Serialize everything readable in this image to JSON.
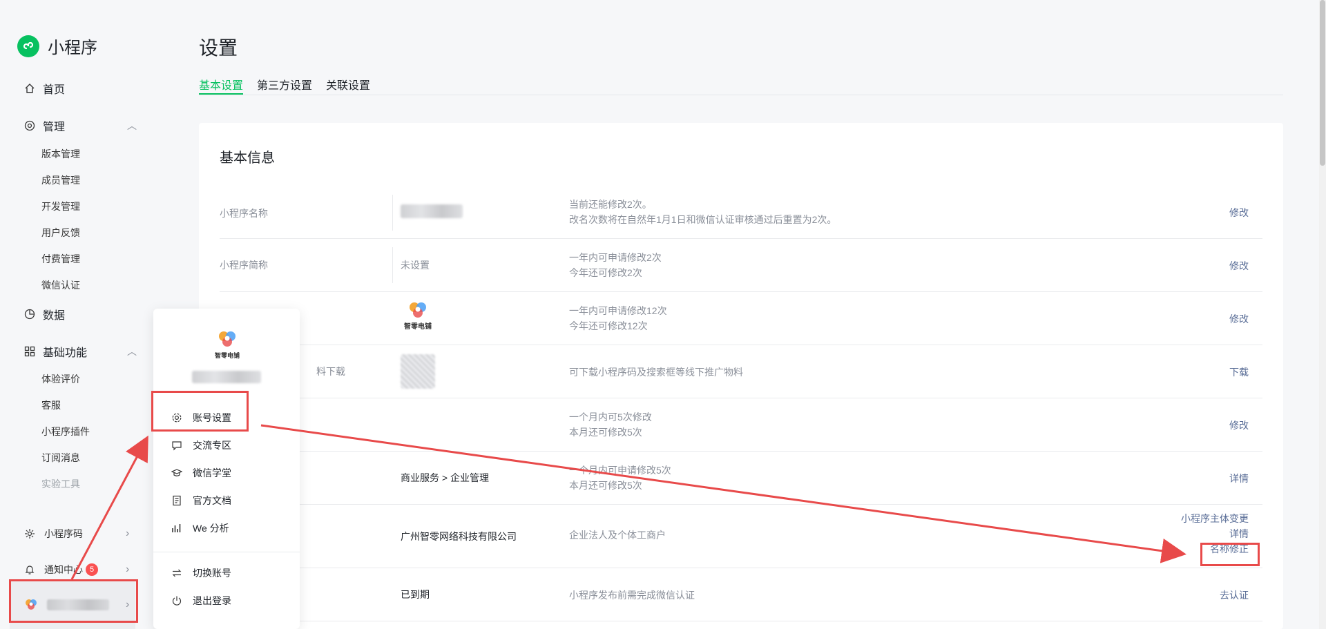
{
  "app": {
    "title": "小程序"
  },
  "sidebar": {
    "home": "首页",
    "manage": "管理",
    "manage_items": [
      "版本管理",
      "成员管理",
      "开发管理",
      "用户反馈",
      "付费管理",
      "微信认证"
    ],
    "data": "数据",
    "basic": "基础功能",
    "basic_items": [
      "体验评价",
      "客服",
      "小程序插件",
      "订阅消息",
      "实验工具"
    ],
    "qrcode": "小程序码",
    "notify": "通知中心",
    "notify_count": "5"
  },
  "page": {
    "title": "设置",
    "tabs": [
      "基本设置",
      "第三方设置",
      "关联设置"
    ],
    "card_title": "基本信息"
  },
  "rows": [
    {
      "label": "小程序名称",
      "value": "",
      "desc1": "当前还能修改2次。",
      "desc2": "改名次数将在自然年1月1日和微信认证审核通过后重置为2次。",
      "action": "修改"
    },
    {
      "label": "小程序简称",
      "value": "未设置",
      "desc1": "一年内可申请修改2次",
      "desc2": "今年还可修改2次",
      "action": "修改"
    },
    {
      "label": "",
      "value": "",
      "logo_caption": "智零电铺",
      "desc1": "一年内可申请修改12次",
      "desc2": "今年还可修改12次",
      "action": "修改"
    },
    {
      "label": "料下载",
      "value": "",
      "desc1": "可下载小程序码及搜索框等线下推广物料",
      "desc2": "",
      "action": "下载"
    },
    {
      "label": "",
      "value": "",
      "desc1": "一个月内可5次修改",
      "desc2": "本月还可修改5次",
      "action": "修改"
    },
    {
      "label": "",
      "value": "商业服务 > 企业管理",
      "desc1": "一个月内可申请修改5次",
      "desc2": "本月还可修改5次",
      "action": "详情"
    },
    {
      "label": "",
      "value": "广州智零网络科技有限公司",
      "desc1": "企业法人及个体工商户",
      "desc2": "",
      "actions": [
        "小程序主体变更",
        "详情",
        "名称修正"
      ]
    },
    {
      "label": "",
      "value": "已到期",
      "desc1": "小程序发布前需完成微信认证",
      "desc2": "",
      "action": "去认证"
    }
  ],
  "popup": {
    "logo_caption": "智零电铺",
    "items": [
      "账号设置",
      "交流专区",
      "微信学堂",
      "官方文档",
      "We 分析"
    ],
    "items2": [
      "切换账号",
      "退出登录"
    ]
  },
  "colors": {
    "accent": "#07c160",
    "link": "#576b95",
    "annotation": "#e84a4a"
  }
}
